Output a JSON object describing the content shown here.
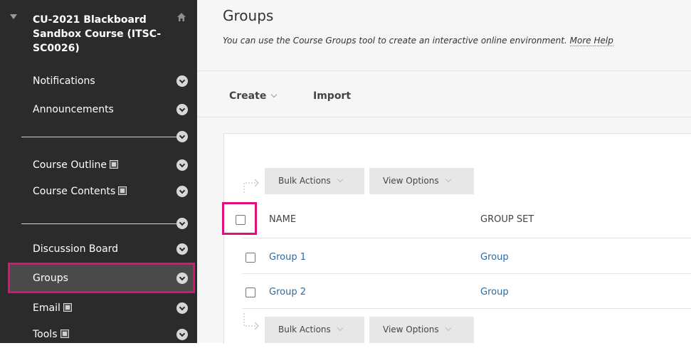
{
  "sidebar": {
    "course_title": "CU-2021 Blackboard Sandbox Course (ITSC-SC0026)",
    "items": [
      {
        "label": "Notifications"
      },
      {
        "label": "Announcements"
      },
      {
        "label": "Course Outline"
      },
      {
        "label": "Course Contents"
      },
      {
        "label": "Discussion Board"
      },
      {
        "label": "Groups"
      },
      {
        "label": "Email"
      },
      {
        "label": "Tools"
      }
    ]
  },
  "page": {
    "title": "Groups",
    "description": "You can use the Course Groups tool to create an interactive online environment.",
    "more_help": "More Help"
  },
  "action_bar": {
    "create_label": "Create",
    "import_label": "Import"
  },
  "table": {
    "bulk_actions_label": "Bulk Actions",
    "view_options_label": "View Options",
    "columns": [
      "NAME",
      "GROUP SET"
    ],
    "rows": [
      {
        "name": "Group 1",
        "group_set": "Group"
      },
      {
        "name": "Group 2",
        "group_set": "Group"
      }
    ]
  },
  "colors": {
    "sidebar_bg": "#2b2b2b",
    "highlight": "#e0107a",
    "link": "#2a6aa6"
  }
}
